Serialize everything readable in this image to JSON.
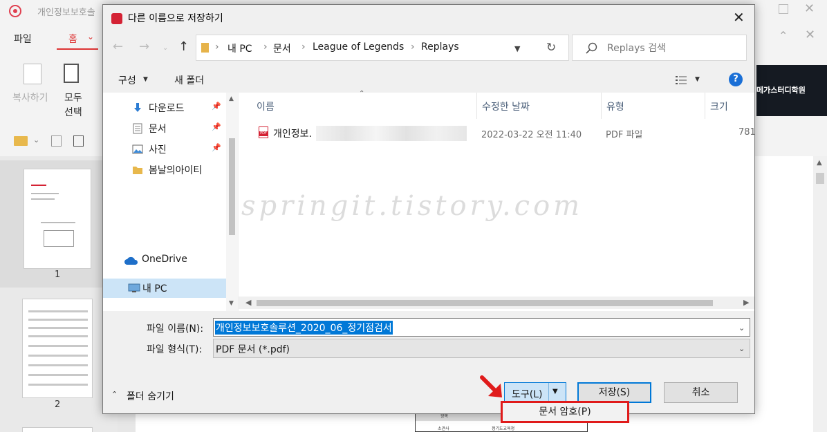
{
  "background_app": {
    "title": "개인정보보호솔",
    "menu": {
      "file": "파일",
      "home": "홈"
    },
    "toolbar": {
      "copy": "복사하기",
      "select_all_line1": "모두",
      "select_all_line2": "선택"
    },
    "thumbnails": [
      {
        "page": "1"
      },
      {
        "page": "2"
      }
    ],
    "banner_text": "메가스터디학원",
    "doc_table": {
      "header": "항목",
      "cell1": "소관사",
      "cell2": "정기도교육청"
    },
    "colors": {
      "brand": "#d42234"
    }
  },
  "dialog": {
    "title": "다른 이름으로 저장하기",
    "address": {
      "crumbs": [
        "내 PC",
        "문서",
        "League of Legends",
        "Replays"
      ],
      "separator": "›"
    },
    "search": {
      "placeholder": "Replays 검색"
    },
    "toolbar": {
      "organize": "구성",
      "new_folder": "새 폴더",
      "help": "?"
    },
    "nav": {
      "items": [
        {
          "label": "다운로드",
          "icon": "download-arrow-icon",
          "pinned": true
        },
        {
          "label": "문서",
          "icon": "document-icon",
          "pinned": true
        },
        {
          "label": "사진",
          "icon": "picture-icon",
          "pinned": true
        },
        {
          "label": "봄날의아이티",
          "icon": "folder-icon",
          "pinned": false
        },
        {
          "label": "OneDrive",
          "icon": "cloud-icon",
          "pinned": false
        },
        {
          "label": "내 PC",
          "icon": "computer-icon",
          "pinned": false,
          "selected": true
        }
      ]
    },
    "columns": {
      "name": "이름",
      "date": "수정한 날짜",
      "type": "유형",
      "size": "크기"
    },
    "files": [
      {
        "name": "개인정보.",
        "date": "2022-03-22 오전 11:40",
        "type": "PDF 파일",
        "size": "781"
      }
    ],
    "watermark": "springit.tistory.com",
    "filename_label": "파일 이름(N):",
    "filename_value": "개인정보보호솔루션_2020_06_정기점검서",
    "filetype_label": "파일 형식(T):",
    "filetype_value": "PDF 문서 (*.pdf)",
    "hide_folders": "폴더 숨기기",
    "buttons": {
      "tools": "도구(L)",
      "save": "저장(S)",
      "cancel": "취소"
    },
    "tools_menu": {
      "encrypt": "문서 암호(P)"
    },
    "colors": {
      "selection": "#0078d7",
      "highlight": "#e01b1b",
      "nav_selected": "#cce4f7"
    }
  }
}
